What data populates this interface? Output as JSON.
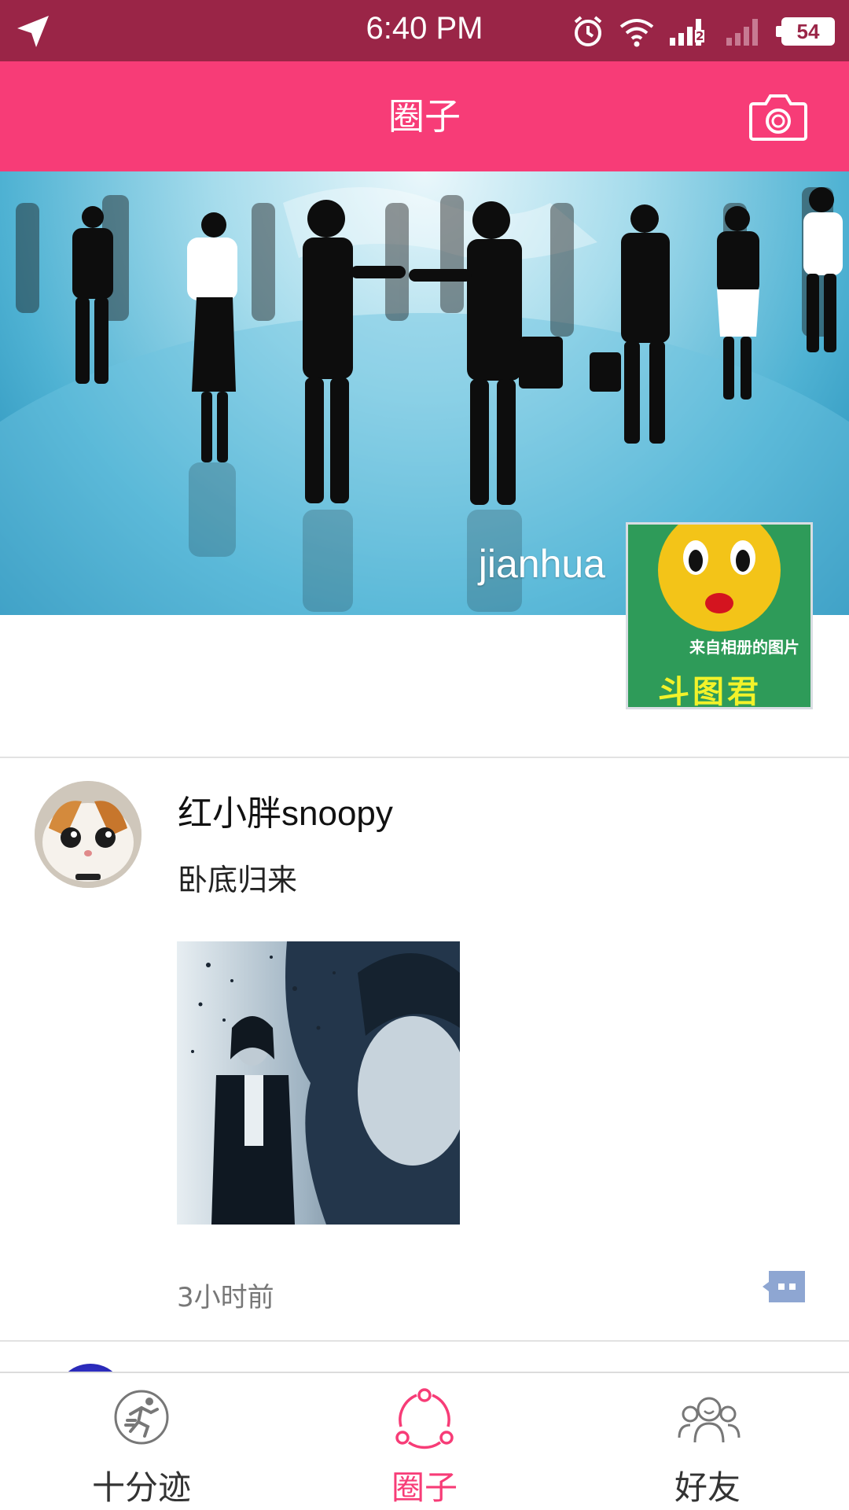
{
  "status_bar": {
    "time": "6:40 PM",
    "battery": "54",
    "sim_badge": "2",
    "icons": [
      "location-arrow-icon",
      "alarm-icon",
      "wifi-icon",
      "signal-icon",
      "signal-weak-icon",
      "battery-icon"
    ]
  },
  "header": {
    "title": "圈子",
    "camera_icon": "camera-icon"
  },
  "cover": {
    "username": "jianhua",
    "profile_avatar_caption": "来自相册的图片",
    "profile_avatar_signature": "斗图君"
  },
  "posts": [
    {
      "username": "红小胖snoopy",
      "text": "卧底归来",
      "time": "3小时前",
      "comment_icon": "comment-icon"
    }
  ],
  "bottom_nav": {
    "items": [
      {
        "label": "十分迹",
        "icon": "running-man-icon",
        "active": false
      },
      {
        "label": "圈子",
        "icon": "circle-share-icon",
        "active": true
      },
      {
        "label": "好友",
        "icon": "friends-icon",
        "active": false
      }
    ]
  },
  "colors": {
    "status_bar": "#9a2547",
    "header": "#f73c77",
    "active": "#f73c77",
    "comment_icon": "#8ea6d2"
  }
}
